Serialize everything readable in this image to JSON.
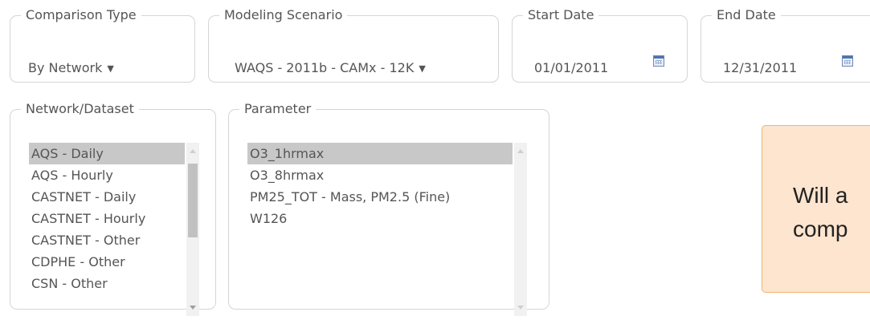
{
  "comparison_type": {
    "legend": "Comparison Type",
    "value": "By Network"
  },
  "modeling_scenario": {
    "legend": "Modeling Scenario",
    "value": "WAQS - 2011b - CAMx - 12K"
  },
  "start_date": {
    "legend": "Start Date",
    "value": "01/01/2011",
    "icon": "calendar-icon"
  },
  "end_date": {
    "legend": "End Date",
    "value": "12/31/2011",
    "icon": "calendar-icon"
  },
  "network_dataset": {
    "legend": "Network/Dataset",
    "items": [
      "AQS - Daily",
      "AQS - Hourly",
      "CASTNET - Daily",
      "CASTNET - Hourly",
      "CASTNET - Other",
      "CDPHE - Other",
      "CSN - Other"
    ],
    "selected": "AQS - Daily"
  },
  "parameter": {
    "legend": "Parameter",
    "items": [
      "O3_1hrmax",
      "O3_8hrmax",
      "PM25_TOT - Mass, PM2.5 (Fine)",
      "W126"
    ],
    "selected": "O3_1hrmax"
  },
  "note": {
    "line1": "Will a",
    "line2": "comp"
  },
  "colors": {
    "selected_bg": "#c8c8c8",
    "note_bg": "#fde5cf",
    "note_border": "#f0b46f",
    "border": "#d5d5d5"
  }
}
